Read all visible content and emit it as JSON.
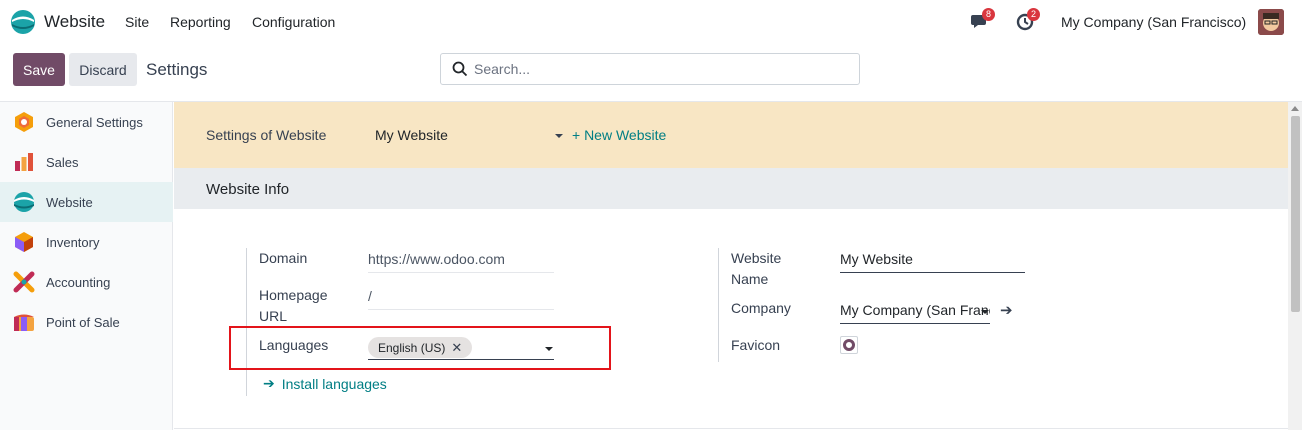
{
  "navbar": {
    "app_name": "Website",
    "menu": [
      "Site",
      "Reporting",
      "Configuration"
    ],
    "messages_count": "8",
    "activities_count": "2",
    "company": "My Company (San Francisco)"
  },
  "control_panel": {
    "save_label": "Save",
    "discard_label": "Discard",
    "title": "Settings",
    "search_placeholder": "Search..."
  },
  "sidebar": {
    "items": [
      {
        "label": "General Settings",
        "icon": "general-settings-icon",
        "active": false
      },
      {
        "label": "Sales",
        "icon": "sales-icon",
        "active": false
      },
      {
        "label": "Website",
        "icon": "website-icon",
        "active": true
      },
      {
        "label": "Inventory",
        "icon": "inventory-icon",
        "active": false
      },
      {
        "label": "Accounting",
        "icon": "accounting-icon",
        "active": false
      },
      {
        "label": "Point of Sale",
        "icon": "point-of-sale-icon",
        "active": false
      }
    ]
  },
  "website_bar": {
    "label": "Settings of Website",
    "selected": "My Website",
    "new_label": "+ New Website"
  },
  "section": {
    "title": "Website Info"
  },
  "fields": {
    "domain_label": "Domain",
    "domain_value": "https://www.odoo.com",
    "homepage_label_1": "Homepage",
    "homepage_label_2": "URL",
    "homepage_value": "/",
    "languages_label": "Languages",
    "language_tag": "English (US)",
    "install_languages": "Install languages",
    "website_name_label_1": "Website",
    "website_name_label_2": "Name",
    "website_name_value": "My Website",
    "company_label": "Company",
    "company_value": "My Company (San Francisco)",
    "favicon_label": "Favicon"
  },
  "colors": {
    "primary": "#714b67",
    "link": "#017e84",
    "highlight_border": "#e3141a",
    "website_bar": "#f8e6c4"
  }
}
